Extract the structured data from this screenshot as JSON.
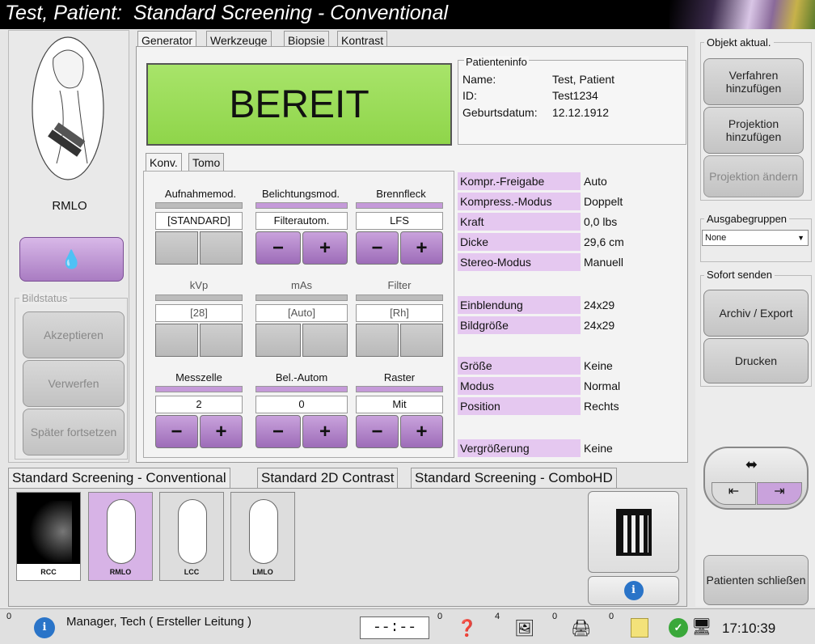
{
  "title": "Test, Patient:  Standard Screening - Conventional",
  "left": {
    "view_label": "RMLO",
    "bildstatus_title": "Bildstatus",
    "accept": "Akzeptieren",
    "reject": "Verwerfen",
    "later": "Später fortsetzen"
  },
  "tabs": [
    "Generator",
    "Werkzeuge",
    "Biopsie",
    "Kontrast"
  ],
  "status_big": "BEREIT",
  "patient": {
    "title": "Patienteninfo",
    "name_label": "Name:",
    "name": "Test, Patient",
    "id_label": "ID:",
    "id": "Test1234",
    "dob_label": "Geburtsdatum:",
    "dob": "12.12.1912"
  },
  "subtabs": [
    "Konv.",
    "Tomo"
  ],
  "controls": {
    "aufnahme": {
      "label": "Aufnahmemod.",
      "value": "[STANDARD]"
    },
    "belichtung": {
      "label": "Belichtungsmod.",
      "value": "Filterautom."
    },
    "brennfleck": {
      "label": "Brennfleck",
      "value": "LFS"
    },
    "kvp": {
      "label": "kVp",
      "value": "[28]"
    },
    "mas": {
      "label": "mAs",
      "value": "[Auto]"
    },
    "filter": {
      "label": "Filter",
      "value": "[Rh]"
    },
    "messzelle": {
      "label": "Messzelle",
      "value": "2"
    },
    "belautom": {
      "label": "Bel.-Autom",
      "value": "0"
    },
    "raster": {
      "label": "Raster",
      "value": "Mit"
    },
    "minus": "−",
    "plus": "+"
  },
  "params": [
    {
      "label": "Kompr.-Freigabe",
      "value": "Auto"
    },
    {
      "label": "Kompress.-Modus",
      "value": "Doppelt"
    },
    {
      "label": "Kraft",
      "value": "0,0 lbs"
    },
    {
      "label": "Dicke",
      "value": "29,6 cm"
    },
    {
      "label": "Stereo-Modus",
      "value": "Manuell"
    },
    {
      "label": "Einblendung",
      "value": "24x29"
    },
    {
      "label": "Bildgröße",
      "value": "24x29"
    },
    {
      "label": "Größe",
      "value": "Keine"
    },
    {
      "label": "Modus",
      "value": "Normal"
    },
    {
      "label": "Position",
      "value": "Rechts"
    },
    {
      "label": "Vergrößerung",
      "value": "Keine"
    }
  ],
  "right": {
    "objekt_title": "Objekt aktual.",
    "add_procedure": "Verfahren hinzufügen",
    "add_projection": "Projektion hinzufügen",
    "change_projection": "Projektion ändern",
    "output_title": "Ausgabegruppen",
    "output_value": "None",
    "send_title": "Sofort senden",
    "archive": "Archiv / Export",
    "print": "Drucken",
    "close_patient": "Patienten schließen"
  },
  "procedure_tabs": [
    "Standard Screening - Conventional",
    "Standard 2D Contrast",
    "Standard Screening - ComboHD"
  ],
  "thumbs": [
    "RCC",
    "RMLO",
    "LCC",
    "LMLO"
  ],
  "statusbar": {
    "count_info": "0",
    "user": "Manager, Tech ( Ersteller Leitung )",
    "timer": "--:--",
    "count_help": "0",
    "count_queue": "4",
    "count_print": "0",
    "count_notes": "0",
    "time": "17:10:39"
  }
}
